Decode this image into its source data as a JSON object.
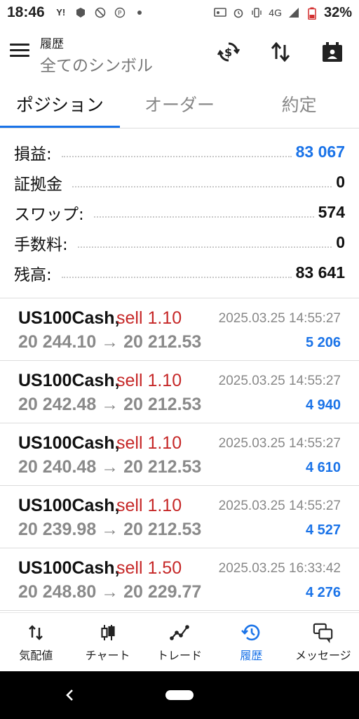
{
  "status_bar": {
    "time": "18:46",
    "network": "4G",
    "battery": "32%"
  },
  "app_bar": {
    "title": "履歴",
    "subtitle": "全てのシンボル"
  },
  "tabs": [
    {
      "label": "ポジション",
      "active": true
    },
    {
      "label": "オーダー",
      "active": false
    },
    {
      "label": "約定",
      "active": false
    }
  ],
  "summary": [
    {
      "label": "損益:",
      "value": "83 067",
      "highlight": true
    },
    {
      "label": "証拠金",
      "value": "0",
      "highlight": false
    },
    {
      "label": "スワップ:",
      "value": "574",
      "highlight": false
    },
    {
      "label": "手数料:",
      "value": "0",
      "highlight": false
    },
    {
      "label": "残高:",
      "value": "83 641",
      "highlight": false
    }
  ],
  "deals": [
    {
      "symbol": "US100Cash,",
      "side": "sell 1.10",
      "time": "2025.03.25 14:55:27",
      "prices": "20 244.10 → 20 212.53",
      "profit": "5 206"
    },
    {
      "symbol": "US100Cash,",
      "side": "sell 1.10",
      "time": "2025.03.25 14:55:27",
      "prices": "20 242.48 → 20 212.53",
      "profit": "4 940"
    },
    {
      "symbol": "US100Cash,",
      "side": "sell 1.10",
      "time": "2025.03.25 14:55:27",
      "prices": "20 240.48 → 20 212.53",
      "profit": "4 610"
    },
    {
      "symbol": "US100Cash,",
      "side": "sell 1.10",
      "time": "2025.03.25 14:55:27",
      "prices": "20 239.98 → 20 212.53",
      "profit": "4 527"
    },
    {
      "symbol": "US100Cash,",
      "side": "sell 1.50",
      "time": "2025.03.25 16:33:42",
      "prices": "20 248.80 → 20 229.77",
      "profit": "4 276"
    }
  ],
  "bottom_nav": [
    {
      "label": "気配値",
      "icon": "quotes-icon",
      "active": false
    },
    {
      "label": "チャート",
      "icon": "chart-candles-icon",
      "active": false
    },
    {
      "label": "トレード",
      "icon": "trade-icon",
      "active": false
    },
    {
      "label": "履歴",
      "icon": "history-icon",
      "active": true
    },
    {
      "label": "メッセージ",
      "icon": "messages-icon",
      "active": false
    }
  ],
  "colors": {
    "accent": "#1a73e8",
    "sell": "#c62828",
    "muted": "#8a8a8a"
  }
}
